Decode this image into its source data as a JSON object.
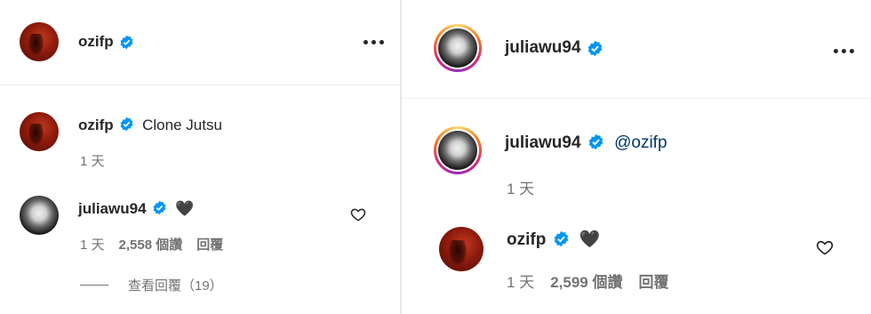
{
  "left": {
    "header": {
      "username": "ozifp"
    },
    "caption": {
      "username": "ozifp",
      "text": "Clone Jutsu",
      "time": "1 天"
    },
    "comment": {
      "username": "juliawu94",
      "emoji": "🖤",
      "time": "1 天",
      "likes": "2,558 個讚",
      "reply": "回覆"
    },
    "view_replies": "查看回覆（19）"
  },
  "right": {
    "header": {
      "username": "juliawu94"
    },
    "caption": {
      "username": "juliawu94",
      "mention": "@ozifp",
      "time": "1 天"
    },
    "comment": {
      "username": "ozifp",
      "emoji": "🖤",
      "time": "1 天",
      "likes": "2,599 個讚",
      "reply": "回覆"
    }
  },
  "colors": {
    "verified": "#0095f6",
    "mention": "#00376b",
    "meta": "#737373"
  }
}
